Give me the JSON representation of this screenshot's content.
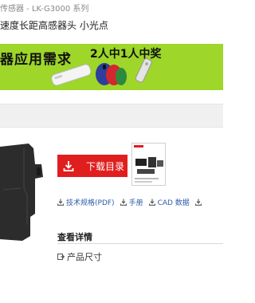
{
  "header": {
    "breadcrumb": "传感器 - LK-G3000 系列",
    "subtitle": "速度长距高感器头 小光点"
  },
  "banner": {
    "title": "器应用需求",
    "promo": "2人中1人中奖",
    "background": "#9ed62a"
  },
  "actions": {
    "download_catalog": "下载目录",
    "accent": "#e01e1e"
  },
  "links": [
    {
      "label": "技术规格(PDF)"
    },
    {
      "label": "手册"
    },
    {
      "label": "CAD 数据"
    }
  ],
  "details": {
    "heading": "查看详情",
    "item": "产品尺寸"
  }
}
